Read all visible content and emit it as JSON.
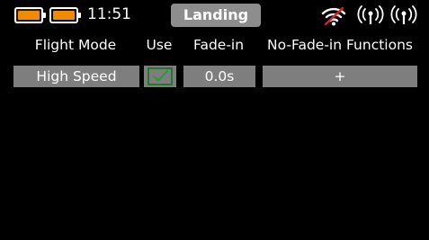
{
  "status_bar": {
    "transmitter_battery_icon": "battery-icon",
    "receiver_battery_icon": "battery-icon",
    "time": "11:51",
    "title": "Landing",
    "wifi_icon": "wifi-off-icon",
    "signal_icon_1": "antenna-signal-icon",
    "signal_icon_2": "antenna-signal-icon"
  },
  "table": {
    "columns": [
      "Flight Mode",
      "Use",
      "Fade-in",
      "No-Fade-in Functions"
    ],
    "rows": [
      {
        "flight_mode": "High Speed",
        "use_checked": true,
        "fade_in": "0.0s",
        "no_fade_functions": "+"
      }
    ]
  },
  "colors": {
    "background": "#000000",
    "cell_background": "#7e7e7e",
    "title_background": "#8d8d8d",
    "battery_fill": "#f08a00",
    "check_color": "#1f7a2a",
    "wifi_disabled": "#e0201b"
  }
}
